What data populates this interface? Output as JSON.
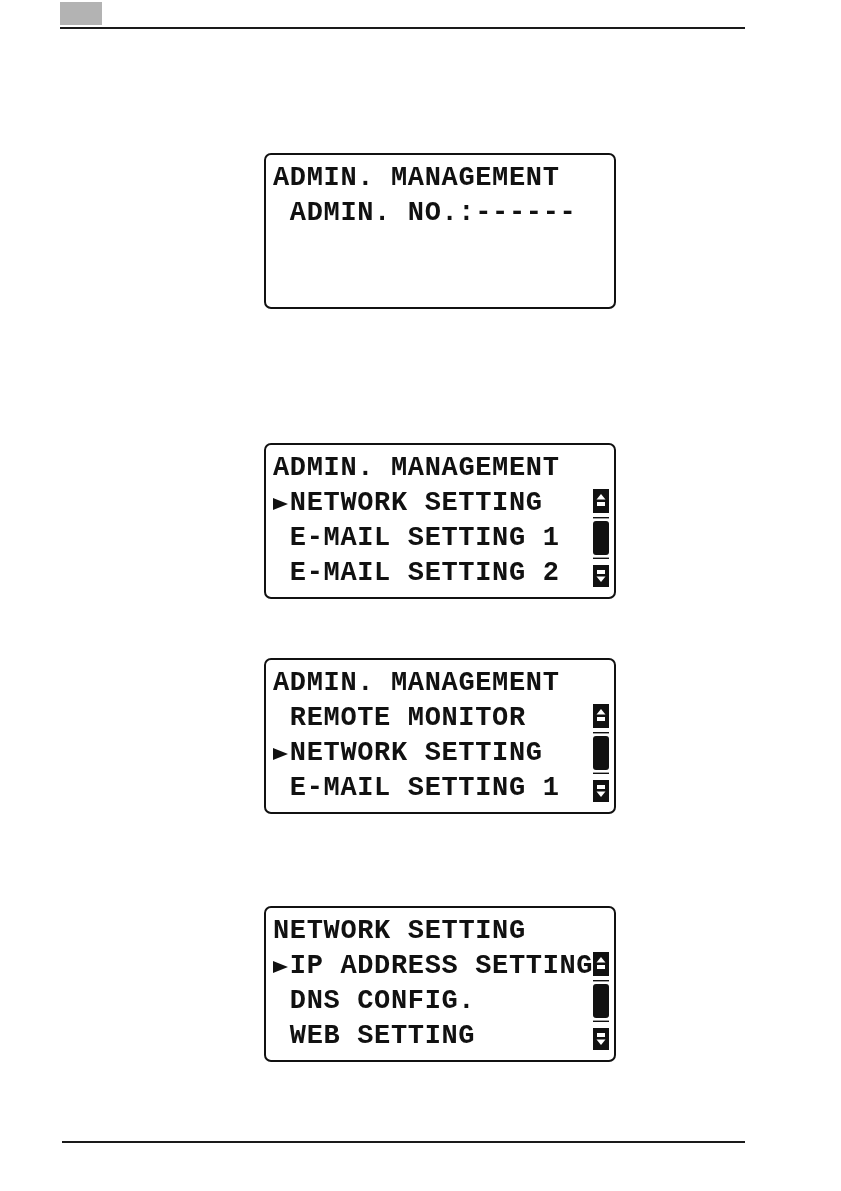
{
  "screens": [
    {
      "scroll_bar": false,
      "lines": [
        {
          "kind": "title",
          "text": "ADMIN. MANAGEMENT"
        },
        {
          "kind": "entry",
          "label": "ADMIN. NO.:",
          "placeholder": "------"
        }
      ]
    },
    {
      "scroll_bar": true,
      "lines": [
        {
          "kind": "title",
          "text": "ADMIN. MANAGEMENT"
        },
        {
          "kind": "item",
          "text": "NETWORK SETTING",
          "selected": true
        },
        {
          "kind": "item",
          "text": "E-MAIL SETTING 1",
          "selected": false
        },
        {
          "kind": "item",
          "text": "E-MAIL SETTING 2",
          "selected": false
        }
      ]
    },
    {
      "scroll_bar": true,
      "lines": [
        {
          "kind": "title",
          "text": "ADMIN. MANAGEMENT"
        },
        {
          "kind": "item",
          "text": "REMOTE MONITOR",
          "selected": false
        },
        {
          "kind": "item",
          "text": "NETWORK SETTING",
          "selected": true
        },
        {
          "kind": "item",
          "text": "E-MAIL SETTING 1",
          "selected": false
        }
      ]
    },
    {
      "scroll_bar": true,
      "lines": [
        {
          "kind": "title",
          "text": "NETWORK SETTING"
        },
        {
          "kind": "item",
          "text": "IP ADDRESS SETTING",
          "selected": true
        },
        {
          "kind": "item",
          "text": "DNS CONFIG.",
          "selected": false
        },
        {
          "kind": "item",
          "text": "WEB SETTING",
          "selected": false
        }
      ]
    }
  ]
}
